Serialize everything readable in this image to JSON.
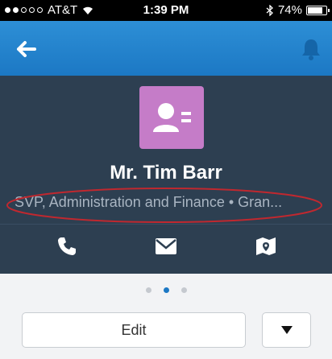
{
  "status_bar": {
    "carrier": "AT&T",
    "time": "1:39 PM",
    "battery": "74%",
    "signal_icon": "signal-dots-icon",
    "wifi_icon": "wifi-icon",
    "bluetooth_icon": "bluetooth-icon",
    "battery_level": 0.74
  },
  "nav": {
    "back_icon": "back-arrow-icon",
    "bell_icon": "bell-icon",
    "background_color": "#1c78c4"
  },
  "profile": {
    "avatar_icon": "contact-card-icon",
    "avatar_color": "#c57cc8",
    "name": "Mr. Tim Barr",
    "subtitle": "SVP, Administration and Finance • Gran...",
    "actions": [
      {
        "icon": "phone-icon"
      },
      {
        "icon": "mail-icon"
      },
      {
        "icon": "map-icon"
      }
    ],
    "highlight_color": "#c0282f"
  },
  "pager": {
    "count": 3,
    "active_index": 1
  },
  "buttons": {
    "edit_label": "Edit",
    "menu_icon": "dropdown-triangle-icon"
  }
}
